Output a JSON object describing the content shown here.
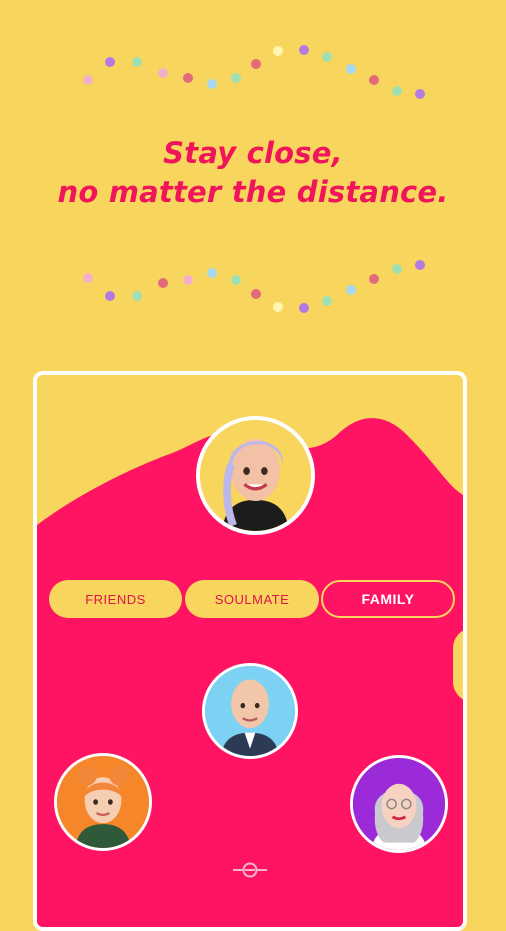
{
  "headline": {
    "line1": "Stay close,",
    "line2": "no matter the distance."
  },
  "colors": {
    "background": "#f8d55d",
    "accent": "#f0155a",
    "card_pink": "#ff1463"
  },
  "relationship_tabs": [
    {
      "label": "FRIENDS",
      "selected": false
    },
    {
      "label": "SOULMATE",
      "selected": false
    },
    {
      "label": "FAMILY",
      "selected": true
    }
  ],
  "avatars": [
    {
      "name": "avatar-lavender-hair",
      "icon": "avatar-icon"
    },
    {
      "name": "avatar-bald-man",
      "icon": "avatar-icon"
    },
    {
      "name": "avatar-orange-hair",
      "icon": "avatar-icon"
    },
    {
      "name": "avatar-grey-hair",
      "icon": "avatar-icon"
    }
  ],
  "bottom_icon": "connection-icon"
}
